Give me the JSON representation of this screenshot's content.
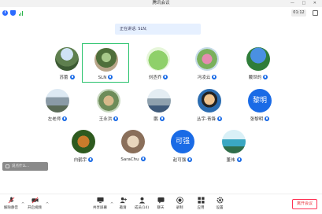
{
  "window": {
    "title": "腾讯会议",
    "controls": "— □ ✕"
  },
  "status": {
    "info_icon": "info-icon",
    "shield_icon": "shield-icon",
    "signal_icon": "signal-icon",
    "timer": "01:12"
  },
  "speaking": {
    "text": "正在讲话: SLN;"
  },
  "participants": [
    {
      "name": "苏蕾",
      "avatar": "landscape-photo",
      "mic": "mic-icon"
    },
    {
      "name": "SLN",
      "avatar": "tree-photo",
      "mic": "mic-icon",
      "active": true
    },
    {
      "name": "刘丞乔",
      "avatar": "frog-cartoon",
      "mic": "mic-icon"
    },
    {
      "name": "冯凌云",
      "avatar": "flower-photo",
      "mic": "mic-icon"
    },
    {
      "name": "戴世的",
      "avatar": "sky-photo",
      "mic": "mic-icon"
    },
    {
      "name": "左老师",
      "avatar": "building-photo",
      "mic": "mic-icon"
    },
    {
      "name": "王永洪",
      "avatar": "dog-photo",
      "mic": "mic-icon"
    },
    {
      "name": "鹏",
      "avatar": "city-photo",
      "mic": "mic-icon"
    },
    {
      "name": "丛宇-青锋",
      "avatar": "anime-photo",
      "mic": "mic-icon"
    },
    {
      "name": "张黎明",
      "avatar_text": "黎明",
      "mic": "mic-icon"
    },
    {
      "name": "白鹤宇",
      "avatar": "tiger-photo",
      "mic": "mic-icon"
    },
    {
      "name": "SaraChu",
      "avatar": "cat-photo",
      "mic": "mic-icon"
    },
    {
      "name": "赵可强",
      "avatar_text": "可强",
      "mic": "mic-icon"
    },
    {
      "name": "董伟",
      "avatar": "coast-photo",
      "mic": "mic-icon"
    }
  ],
  "chat": {
    "placeholder": "说点什么..."
  },
  "toolbar": {
    "mute": "解除静音",
    "video": "开启视频",
    "share": "共享屏幕",
    "invite": "邀请",
    "members": "成员(14)",
    "chat": "聊天",
    "record": "录制",
    "apps": "应用",
    "settings": "设置",
    "leave": "离开会议"
  },
  "colors": {
    "accent": "#1a6be6",
    "active_border": "#27c26b",
    "leave_red": "#e8323c",
    "speaking_bg": "#e6f0ff"
  }
}
